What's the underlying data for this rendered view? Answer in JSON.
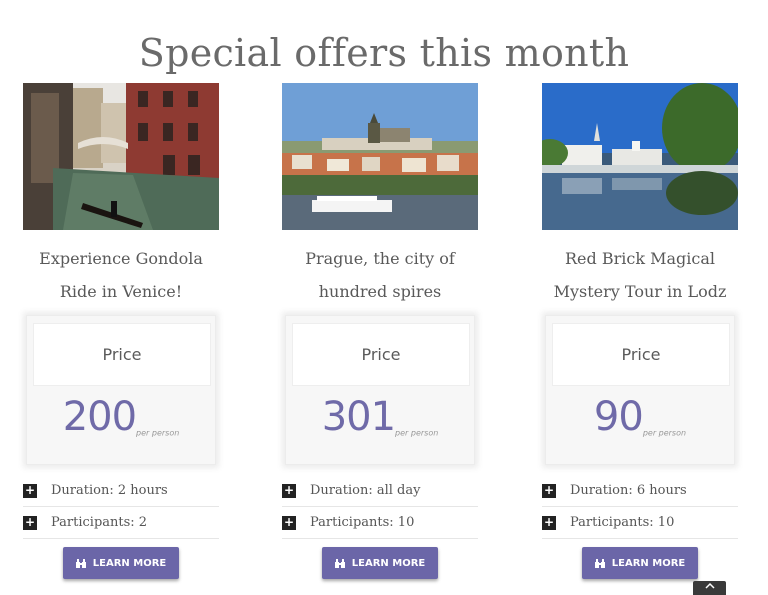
{
  "page": {
    "title": "Special offers this month"
  },
  "offers": [
    {
      "name": "Experience Gondola Ride in Venice!",
      "price_label": "Price",
      "price": "200",
      "price_unit": "per person",
      "duration": "Duration: 2 hours",
      "participants": "Participants: 2",
      "button": "LEARN MORE",
      "image_icon": "venice-canal-photo"
    },
    {
      "name": "Prague, the city of hundred spires",
      "price_label": "Price",
      "price": "301",
      "price_unit": "per person",
      "duration": "Duration: all day",
      "participants": "Participants: 10",
      "button": "LEARN MORE",
      "image_icon": "prague-castle-photo"
    },
    {
      "name": "Red Brick Magical Mystery Tour in Lodz",
      "price_label": "Price",
      "price": "90",
      "price_unit": "per person",
      "duration": "Duration: 6 hours",
      "participants": "Participants: 10",
      "button": "LEARN MORE",
      "image_icon": "lodz-palace-photo"
    }
  ],
  "icons": {
    "info": "plus-icon",
    "button": "binoculars-icon",
    "scroll_top": "chevron-up-icon"
  },
  "colors": {
    "accent": "#6b66a8",
    "price_text": "#6f6aa8",
    "title": "#6a6a6a"
  }
}
